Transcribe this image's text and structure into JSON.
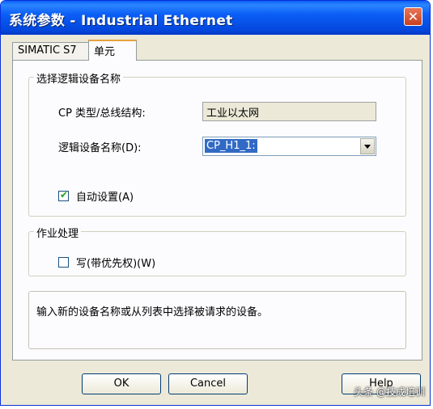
{
  "window": {
    "title": "系统参数 - Industrial Ethernet",
    "close_glyph": "✕"
  },
  "tabs": [
    {
      "label": "SIMATIC S7",
      "active": false
    },
    {
      "label": "单元",
      "active": true
    }
  ],
  "logical_group": {
    "title": "选择逻辑设备名称",
    "cp_type_label": "CP 类型/总线结构:",
    "cp_type_value": "工业以太网",
    "device_name_label": "逻辑设备名称(D):",
    "device_name_value": "CP_H1_1:",
    "auto_setting_label": "自动设置(A)",
    "auto_setting_checked": true
  },
  "job_group": {
    "title": "作业处理",
    "write_priority_label": "写(带优先权)(W)",
    "write_priority_checked": false
  },
  "info_text": "输入新的设备名称或从列表中选择被请求的设备。",
  "buttons": {
    "ok": "OK",
    "cancel": "Cancel",
    "help": "Help"
  },
  "watermark": "头条 @技成培训",
  "colors": {
    "title_bar": "#0a5ef6",
    "selection": "#316ac5",
    "dialog_bg": "#ece9d8"
  }
}
